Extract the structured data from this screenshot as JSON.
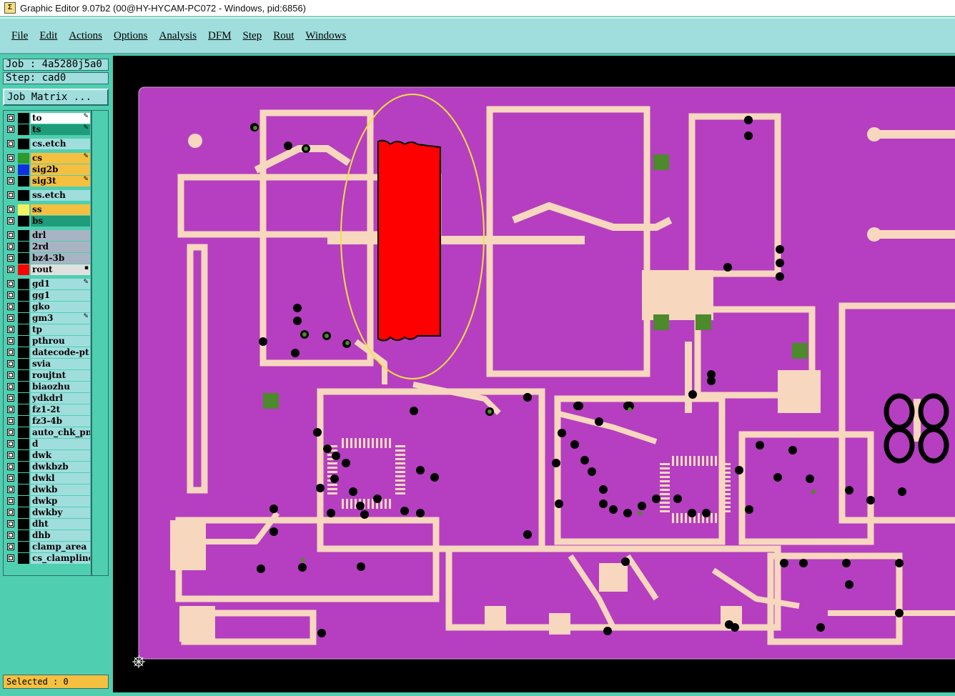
{
  "window": {
    "title": "Graphic Editor 9.07b2 (00@HY-HYCAM-PC072 - Windows, pid:6856)"
  },
  "menu": [
    "File",
    "Edit",
    "Actions",
    "Options",
    "Analysis",
    "DFM",
    "Step",
    "Rout",
    "Windows"
  ],
  "job": {
    "job_label": "Job : 4a5280j5a0",
    "step_label": "Step: cad0",
    "matrix_button": "Job Matrix ..."
  },
  "layers": [
    {
      "name": "to",
      "bg": "#ffffff",
      "swatch": "#000000",
      "mark": "edit"
    },
    {
      "name": "ts",
      "bg": "#1f9c7a",
      "swatch": "#000000",
      "mark": "edit"
    },
    {
      "name": "cs.etch",
      "bg": "#9fdedd",
      "swatch": "#000000",
      "mark": ""
    },
    {
      "name": "cs",
      "bg": "#f5c040",
      "swatch": "#2e9a2e",
      "mark": "edit"
    },
    {
      "name": "sig2b",
      "bg": "#f5c040",
      "swatch": "#1030e0",
      "mark": ""
    },
    {
      "name": "sig3t",
      "bg": "#f5c040",
      "swatch": "#000000",
      "mark": "edit"
    },
    {
      "name": "ss.etch",
      "bg": "#9fdedd",
      "swatch": "#000000",
      "mark": ""
    },
    {
      "name": "ss",
      "bg": "#f5c040",
      "swatch": "#f4f060",
      "mark": ""
    },
    {
      "name": "bs",
      "bg": "#1f9c7a",
      "swatch": "#000000",
      "mark": ""
    },
    {
      "name": "drl",
      "bg": "#a8b4c4",
      "swatch": "#000000",
      "mark": ""
    },
    {
      "name": "2rd",
      "bg": "#a8b4c4",
      "swatch": "#000000",
      "mark": ""
    },
    {
      "name": "bz4-3b",
      "bg": "#a8b4c4",
      "swatch": "#000000",
      "mark": ""
    },
    {
      "name": "rout",
      "bg": "#e0e0e0",
      "swatch": "#ff0000",
      "mark": "sel"
    },
    {
      "name": "gd1",
      "bg": "#9fdedd",
      "swatch": "#000000",
      "mark": "edit"
    },
    {
      "name": "gg1",
      "bg": "#9fdedd",
      "swatch": "#000000",
      "mark": ""
    },
    {
      "name": "gko",
      "bg": "#9fdedd",
      "swatch": "#000000",
      "mark": ""
    },
    {
      "name": "gm3",
      "bg": "#9fdedd",
      "swatch": "#000000",
      "mark": "edit"
    },
    {
      "name": "tp",
      "bg": "#9fdedd",
      "swatch": "#000000",
      "mark": ""
    },
    {
      "name": "pthrou",
      "bg": "#9fdedd",
      "swatch": "#000000",
      "mark": ""
    },
    {
      "name": "datecode-pt",
      "bg": "#9fdedd",
      "swatch": "#000000",
      "mark": ""
    },
    {
      "name": "svia",
      "bg": "#9fdedd",
      "swatch": "#000000",
      "mark": ""
    },
    {
      "name": "roujtnt",
      "bg": "#9fdedd",
      "swatch": "#000000",
      "mark": ""
    },
    {
      "name": "biaozhu",
      "bg": "#9fdedd",
      "swatch": "#000000",
      "mark": ""
    },
    {
      "name": "ydkdrl",
      "bg": "#9fdedd",
      "swatch": "#000000",
      "mark": ""
    },
    {
      "name": "fz1-2t",
      "bg": "#9fdedd",
      "swatch": "#000000",
      "mark": ""
    },
    {
      "name": "fz3-4b",
      "bg": "#9fdedd",
      "swatch": "#000000",
      "mark": ""
    },
    {
      "name": "auto_chk_pn",
      "bg": "#9fdedd",
      "swatch": "#000000",
      "mark": ""
    },
    {
      "name": "d",
      "bg": "#9fdedd",
      "swatch": "#000000",
      "mark": ""
    },
    {
      "name": "dwk",
      "bg": "#9fdedd",
      "swatch": "#000000",
      "mark": ""
    },
    {
      "name": "dwkbzb",
      "bg": "#9fdedd",
      "swatch": "#000000",
      "mark": ""
    },
    {
      "name": "dwkl",
      "bg": "#9fdedd",
      "swatch": "#000000",
      "mark": ""
    },
    {
      "name": "dwkb",
      "bg": "#9fdedd",
      "swatch": "#000000",
      "mark": ""
    },
    {
      "name": "dwkp",
      "bg": "#9fdedd",
      "swatch": "#000000",
      "mark": ""
    },
    {
      "name": "dwkby",
      "bg": "#9fdedd",
      "swatch": "#000000",
      "mark": ""
    },
    {
      "name": "dht",
      "bg": "#9fdedd",
      "swatch": "#000000",
      "mark": ""
    },
    {
      "name": "dhb",
      "bg": "#9fdedd",
      "swatch": "#000000",
      "mark": ""
    },
    {
      "name": "clamp_area",
      "bg": "#9fdedd",
      "swatch": "#000000",
      "mark": ""
    },
    {
      "name": "cs_clampline",
      "bg": "#9fdedd",
      "swatch": "#000000",
      "mark": ""
    }
  ],
  "status": {
    "selected": "Selected : 0"
  },
  "colors": {
    "board": "#b53fc0",
    "copper": "#f8d7bf",
    "highlight": "#ff0000",
    "ellipse": "#f0e040",
    "via": "#000000",
    "via_green": "#4c8a2c"
  },
  "icons": {
    "app": "app-icon",
    "origin": "origin-marker-icon"
  }
}
